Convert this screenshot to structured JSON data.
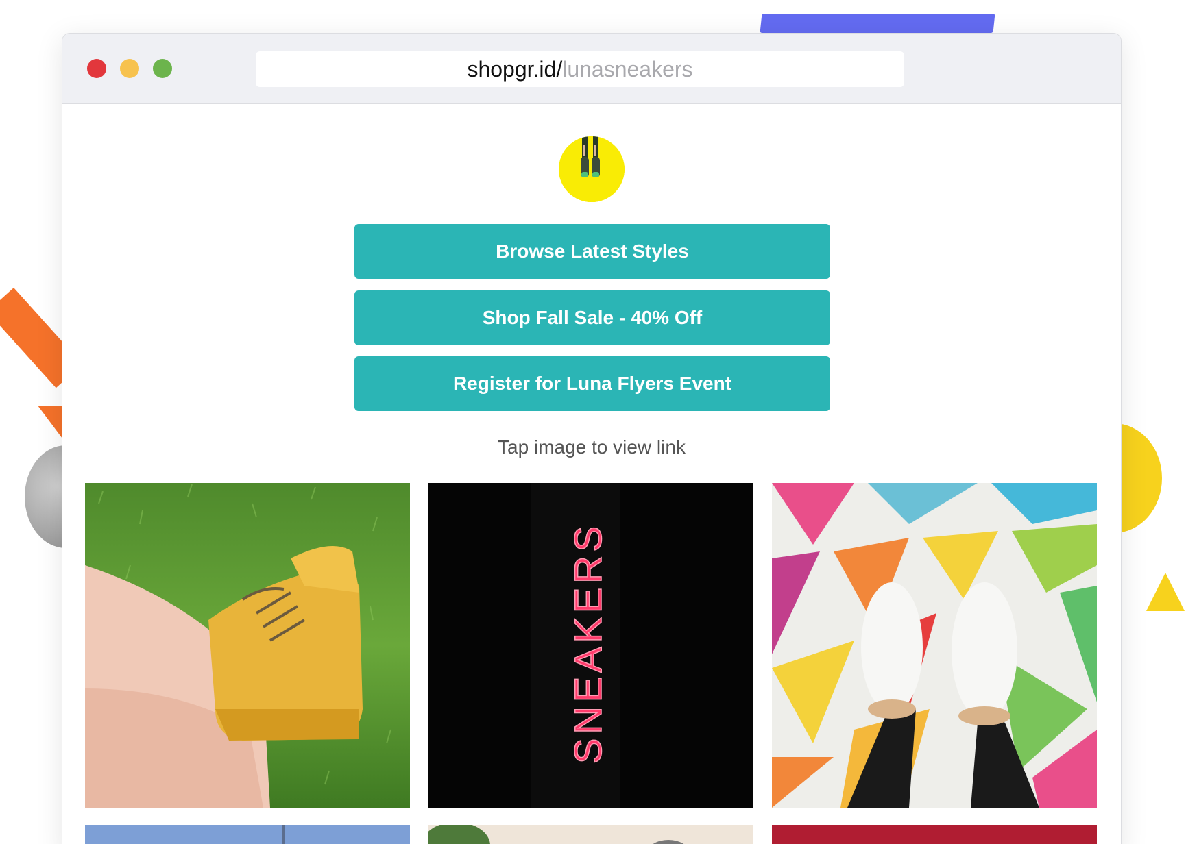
{
  "browser": {
    "url_host": "shopgr.id/",
    "url_path": "lunasneakers"
  },
  "profile": {
    "avatar_icon": "sneakers-avatar"
  },
  "links": [
    {
      "label": "Browse Latest Styles"
    },
    {
      "label": "Shop Fall Sale - 40% Off"
    },
    {
      "label": "Register for Luna Flyers Event"
    }
  ],
  "hint": "Tap image to view link",
  "gallery": {
    "neon_sign_text": "SNEAKERS",
    "tiles": [
      {
        "icon": "yellow-sneakers-on-grass-image"
      },
      {
        "icon": "neon-sneakers-sign-image"
      },
      {
        "icon": "white-sneakers-on-colorful-floor-image"
      },
      {
        "icon": "blue-sky-image"
      },
      {
        "icon": "plant-image"
      },
      {
        "icon": "red-image"
      }
    ]
  },
  "colors": {
    "accent": "#2bb5b5",
    "avatar_bg": "#f9ec05",
    "traffic_red": "#e2373c",
    "traffic_yellow": "#f7c24e",
    "traffic_green": "#6cb44c"
  }
}
